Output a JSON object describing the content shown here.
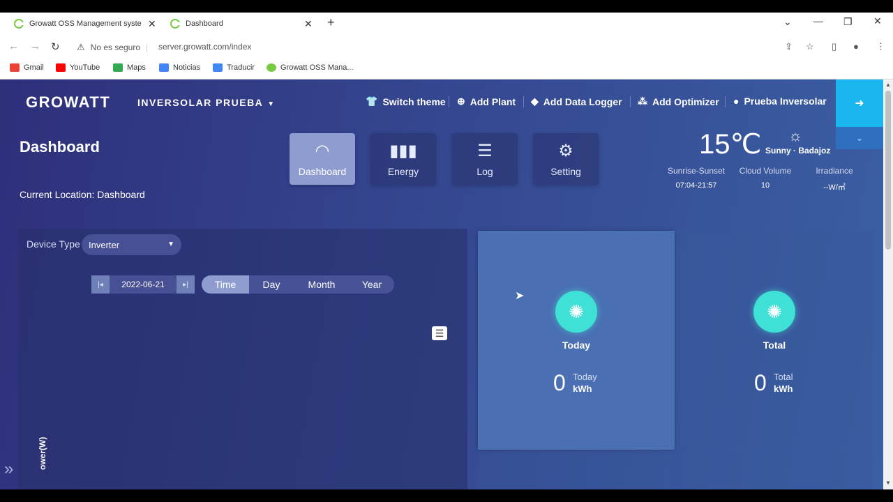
{
  "browser": {
    "tabs": [
      {
        "title": "Growatt OSS Management syste"
      },
      {
        "title": "Dashboard"
      }
    ],
    "security": "No es seguro",
    "url": "server.growatt.com/index",
    "bookmarks": [
      {
        "label": "Gmail",
        "color": "#ea4335"
      },
      {
        "label": "YouTube",
        "color": "#ff0000"
      },
      {
        "label": "Maps",
        "color": "#34a853"
      },
      {
        "label": "Noticias",
        "color": "#4285f4"
      },
      {
        "label": "Traducir",
        "color": "#4285f4"
      },
      {
        "label": "Growatt OSS Mana...",
        "color": "#7ac943"
      }
    ]
  },
  "header": {
    "logo": "GROWATT",
    "plant": "INVERSOLAR PRUEBA",
    "nav": [
      {
        "label": "Switch theme",
        "icon": "shirt-icon"
      },
      {
        "label": "Add Plant",
        "icon": "plus-circle-icon"
      },
      {
        "label": "Add Data Logger",
        "icon": "tag-icon"
      },
      {
        "label": "Add Optimizer",
        "icon": "group-icon"
      },
      {
        "label": "Prueba Inversolar",
        "icon": "user-icon"
      }
    ]
  },
  "main": {
    "title": "Dashboard",
    "location": "Current Location: Dashboard",
    "tiles": [
      {
        "label": "Dashboard",
        "icon": "gauge-icon",
        "active": true
      },
      {
        "label": "Energy",
        "icon": "bar-chart-icon"
      },
      {
        "label": "Log",
        "icon": "list-icon"
      },
      {
        "label": "Setting",
        "icon": "gear-icon"
      }
    ]
  },
  "weather": {
    "temp": "15℃",
    "condition": "Sunny · Badajoz",
    "sunrise_label": "Sunrise-Sunset",
    "sunrise_value": "07:04-21:57",
    "cloud_label": "Cloud Volume",
    "cloud_value": "10",
    "irradiance_label": "Irradiance",
    "irradiance_value": "--W/㎡"
  },
  "chart_panel": {
    "device_type_label": "Device Type",
    "device_type_value": "Inverter",
    "date": "2022-06-21",
    "ranges": [
      "Time",
      "Day",
      "Month",
      "Year"
    ],
    "active_range": "Time",
    "y_axis_label": "ower(W)"
  },
  "stats": {
    "today": {
      "label": "Today",
      "value": "0",
      "unit_top": "Today",
      "unit_bottom": "kWh"
    },
    "total": {
      "label": "Total",
      "value": "0",
      "unit_top": "Total",
      "unit_bottom": "kWh"
    }
  }
}
